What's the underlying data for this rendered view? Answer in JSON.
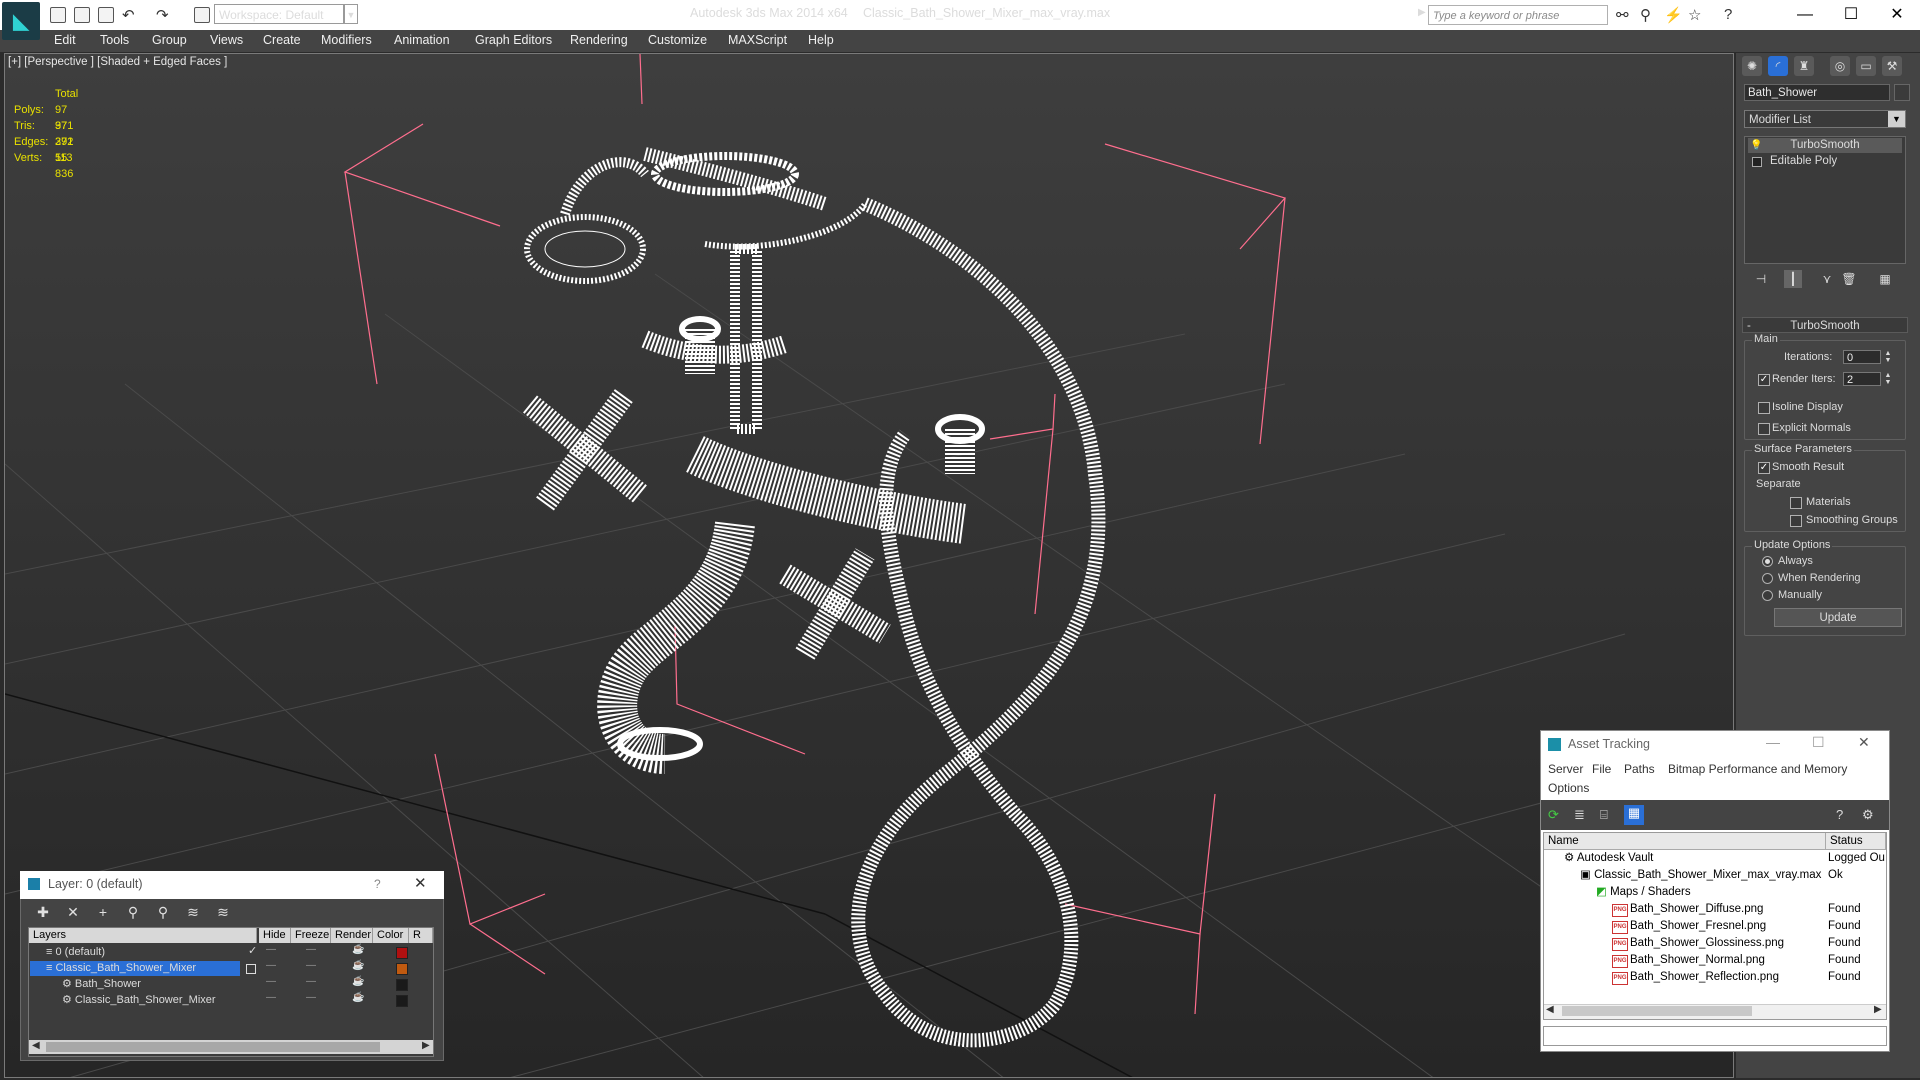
{
  "titlebar": {
    "workspace_label": "Workspace: Default",
    "app_title": "Autodesk 3ds Max  2014 x64",
    "document_title": "Classic_Bath_Shower_Mixer_max_vray.max",
    "search_placeholder": "Type a keyword or phrase"
  },
  "menu": [
    "Edit",
    "Tools",
    "Group",
    "Views",
    "Create",
    "Modifiers",
    "Animation",
    "Graph Editors",
    "Rendering",
    "Customize",
    "MAXScript",
    "Help"
  ],
  "viewport": {
    "label": "[+] [Perspective ] [Shaded + Edged Faces ]",
    "stats": {
      "header": "Total",
      "rows": [
        {
          "label": "Polys:",
          "value": "97 371"
        },
        {
          "label": "Tris:",
          "value": "97 371"
        },
        {
          "label": "Edges:",
          "value": "292 113"
        },
        {
          "label": "Verts:",
          "value": "55 836"
        }
      ]
    }
  },
  "command_panel": {
    "object_name": "Bath_Shower",
    "modifier_list": "Modifier List",
    "stack": [
      "TurboSmooth",
      "Editable Poly"
    ],
    "rollout_title": "TurboSmooth",
    "main_group": "Main",
    "iterations_label": "Iterations:",
    "iterations_value": "0",
    "render_iters_label": "Render Iters:",
    "render_iters_value": "2",
    "isoline_label": "Isoline Display",
    "explicit_normals_label": "Explicit Normals",
    "surface_group": "Surface Parameters",
    "smooth_result_label": "Smooth Result",
    "separate_label": "Separate",
    "materials_label": "Materials",
    "smoothing_groups_label": "Smoothing Groups",
    "update_group": "Update Options",
    "always_label": "Always",
    "when_rendering_label": "When Rendering",
    "manually_label": "Manually",
    "update_button": "Update"
  },
  "layer_dialog": {
    "title": "Layer: 0 (default)",
    "help": "?",
    "columns": [
      "Layers",
      "Hide",
      "Freeze",
      "Render",
      "Color",
      "R"
    ],
    "rows": [
      {
        "name": "0 (default)",
        "color": "#b01010"
      },
      {
        "name": "Classic_Bath_Shower_Mixer",
        "color": "#c05a10"
      },
      {
        "name": "Bath_Shower",
        "color": "#1a1a1a"
      },
      {
        "name": "Classic_Bath_Shower_Mixer",
        "color": "#1a1a1a"
      }
    ]
  },
  "asset_tracking": {
    "title": "Asset Tracking",
    "menu": [
      "Server",
      "File",
      "Paths",
      "Bitmap Performance and Memory",
      "Options"
    ],
    "columns": [
      "Name",
      "Status"
    ],
    "rows": [
      {
        "name": "Autodesk Vault",
        "status": "Logged Ou"
      },
      {
        "name": "Classic_Bath_Shower_Mixer_max_vray.max",
        "status": "Ok"
      },
      {
        "name": "Maps / Shaders",
        "status": ""
      },
      {
        "name": "Bath_Shower_Diffuse.png",
        "status": "Found"
      },
      {
        "name": "Bath_Shower_Fresnel.png",
        "status": "Found"
      },
      {
        "name": "Bath_Shower_Glossiness.png",
        "status": "Found"
      },
      {
        "name": "Bath_Shower_Normal.png",
        "status": "Found"
      },
      {
        "name": "Bath_Shower_Reflection.png",
        "status": "Found"
      }
    ],
    "png_badge": "PNG"
  },
  "colors": {
    "ui_dark": "#444444",
    "viewport": "#2f2f2f",
    "selection": "#2a6fd6",
    "stats_yellow": "#e8e000",
    "bbox_pink": "#ff6e8e"
  },
  "icons": [
    "app-logo-icon",
    "search-icon",
    "star-icon",
    "help-icon",
    "layer-icon",
    "asset-vault-icon"
  ]
}
